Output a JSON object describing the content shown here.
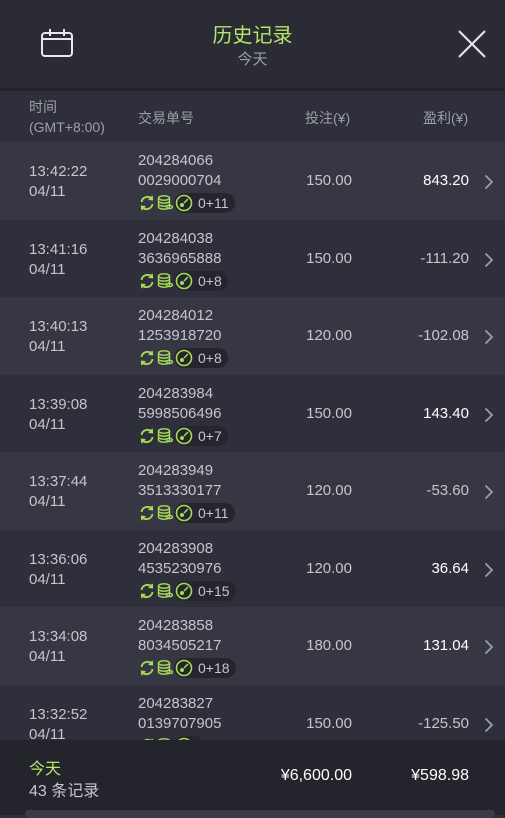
{
  "header": {
    "title": "历史记录",
    "subtitle": "今天",
    "calendar_icon": "calendar-icon",
    "close_icon": "close-icon",
    "accent_color": "#b5e66a"
  },
  "columns": {
    "time_line1": "时间",
    "time_line2": "(GMT+8:00)",
    "order_id": "交易单号",
    "bet": "投注(¥)",
    "profit": "盈利(¥)"
  },
  "rows": [
    {
      "time": "13:42:22",
      "date": "04/11",
      "id_line1": "204284066",
      "id_line2": "0029000704",
      "count": "0+11",
      "bet": "150.00",
      "profit": "843.20",
      "positive": true
    },
    {
      "time": "13:41:16",
      "date": "04/11",
      "id_line1": "204284038",
      "id_line2": "3636965888",
      "count": "0+8",
      "bet": "150.00",
      "profit": "-111.20",
      "positive": false
    },
    {
      "time": "13:40:13",
      "date": "04/11",
      "id_line1": "204284012",
      "id_line2": "1253918720",
      "count": "0+8",
      "bet": "120.00",
      "profit": "-102.08",
      "positive": false
    },
    {
      "time": "13:39:08",
      "date": "04/11",
      "id_line1": "204283984",
      "id_line2": "5998506496",
      "count": "0+7",
      "bet": "150.00",
      "profit": "143.40",
      "positive": true
    },
    {
      "time": "13:37:44",
      "date": "04/11",
      "id_line1": "204283949",
      "id_line2": "3513330177",
      "count": "0+11",
      "bet": "120.00",
      "profit": "-53.60",
      "positive": false
    },
    {
      "time": "13:36:06",
      "date": "04/11",
      "id_line1": "204283908",
      "id_line2": "4535230976",
      "count": "0+15",
      "bet": "120.00",
      "profit": "36.64",
      "positive": true
    },
    {
      "time": "13:34:08",
      "date": "04/11",
      "id_line1": "204283858",
      "id_line2": "8034505217",
      "count": "0+18",
      "bet": "180.00",
      "profit": "131.04",
      "positive": true
    },
    {
      "time": "13:32:52",
      "date": "04/11",
      "id_line1": "204283827",
      "id_line2": "0139707905",
      "count": "",
      "bet": "150.00",
      "profit": "-125.50",
      "positive": false
    }
  ],
  "footer": {
    "label": "今天",
    "count": "43 条记录",
    "total_bet": "¥6,600.00",
    "total_profit": "¥598.98"
  }
}
